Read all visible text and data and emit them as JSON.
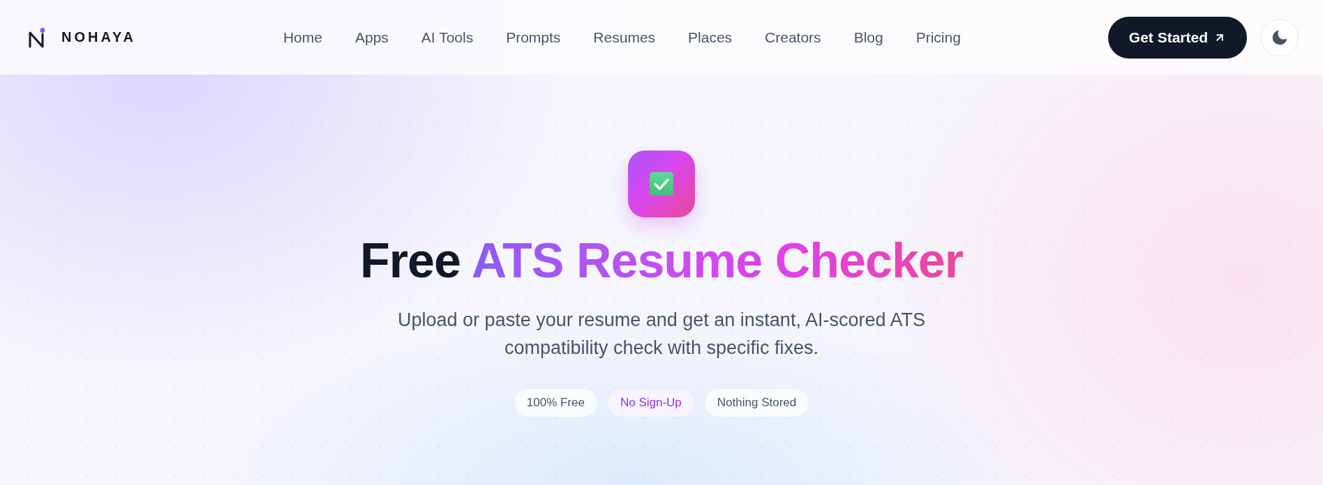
{
  "header": {
    "logo": {
      "text": "NOHAYA"
    },
    "nav": [
      "Home",
      "Apps",
      "AI Tools",
      "Prompts",
      "Resumes",
      "Places",
      "Creators",
      "Blog",
      "Pricing"
    ],
    "cta": {
      "label": "Get Started"
    }
  },
  "hero": {
    "title_lead": "Free",
    "title_highlight": "ATS Resume Checker",
    "subtitle": "Upload or paste your resume and get an instant, AI-scored ATS compatibility check with specific fixes.",
    "badges": [
      {
        "label": "100% Free",
        "highlighted": false
      },
      {
        "label": "No Sign-Up",
        "highlighted": true
      },
      {
        "label": "Nothing Stored",
        "highlighted": false
      }
    ]
  }
}
